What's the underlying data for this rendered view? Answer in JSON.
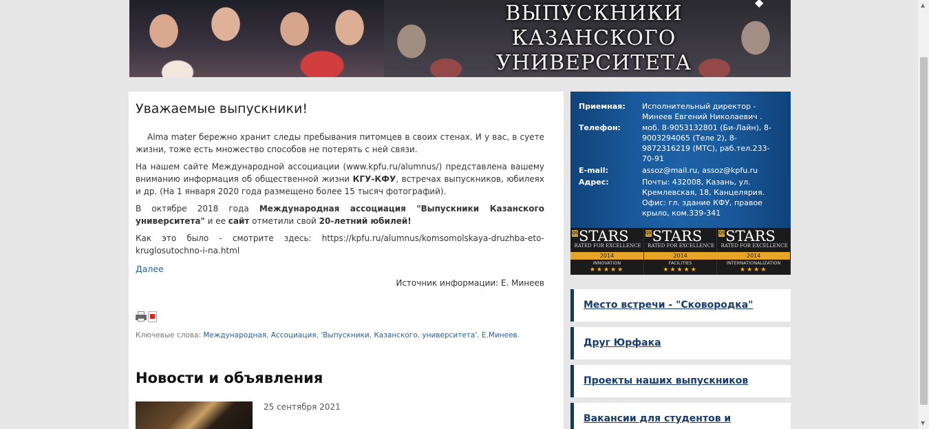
{
  "banner": {
    "title_line1": "ВЫПУСКНИКИ КАЗАНСКОГО",
    "title_line2": "УНИВЕРСИТЕТА"
  },
  "article": {
    "title": "Уважаемые выпускники!",
    "p1": "Alma mater бережно хранит следы пребывания питомцев в своих стенах. И у вас, в суете жизни, тоже есть множество способов не потерять с ней связи.",
    "p2_a": "На нашем сайте Международной ассоциации (www.kpfu.ru/alumnus/) представлена вашему вниманию информация об общественной жизни ",
    "p2_b": "КГУ-КФУ",
    "p2_c": ", встречах выпускников, юбилеях и др. (На 1 января 2020 года размещено более 15 тысяч фотографий).",
    "p3_a": "В октябре 2018 года ",
    "p3_b": "Международная ассоциация \"Выпускники Казанского университета\"",
    "p3_c": " и ее ",
    "p3_d": "сайт",
    "p3_e": " отметили свой ",
    "p3_f": "20-летний юбилей!",
    "p4": "Как это было - смотрите здесь: https://kpfu.ru/alumnus/komsomolskaya-druzhba-eto-kruglosutochno-i-na.html",
    "read_more": "Далее",
    "source": "Источник информации: Е. Минеев",
    "tags_label": "Ключевые слова: ",
    "tags": [
      "Международная",
      "Ассоциация",
      "'Выпускники",
      "Казанского",
      "университета'",
      "Е.Минеев"
    ]
  },
  "news": {
    "heading": "Новости и объявления",
    "items": [
      {
        "date": "25 сентября 2021"
      }
    ]
  },
  "contact": {
    "rows": [
      {
        "label": "Приемная:",
        "value": "Исполнительный директор - Минеев Евгений Николаевич ."
      },
      {
        "label": "Телефон:",
        "value": "моб. 8-9053132801 (Би-Лайн), 8-9003294065 (Теле 2), 8-9872316219 (МТС), раб.тел.233-70-91"
      },
      {
        "label": "E-mail:",
        "value": "assoz@mail.ru, assoz@kpfu.ru"
      },
      {
        "label": "Адрес:",
        "value": "Почты: 432008, Казань, ул. Кремлевская, 18, Канцелярия. Офис: гл. здание КФУ, правое крыло, ком.339-341"
      }
    ]
  },
  "stars": {
    "word": "STARS",
    "rated": "RATED FOR EXCELLENCE",
    "qs": "QS",
    "cells": [
      {
        "year": "2014",
        "category": "INNOVATION"
      },
      {
        "year": "2014",
        "category": "FACILITIES"
      },
      {
        "year": "2014",
        "category": "INTERNATIONALIZATION"
      }
    ]
  },
  "sidebar": {
    "links": [
      "Место встречи - \"Сковородка\"",
      "Друг Юрфака",
      "Проекты наших выпускников",
      "Вакансии для студентов и выпускников"
    ]
  },
  "colors": {
    "accent": "#0d3b6e",
    "link": "#2b5b93",
    "contact_bg": "#1a5a9c",
    "gold": "#e8a426"
  }
}
